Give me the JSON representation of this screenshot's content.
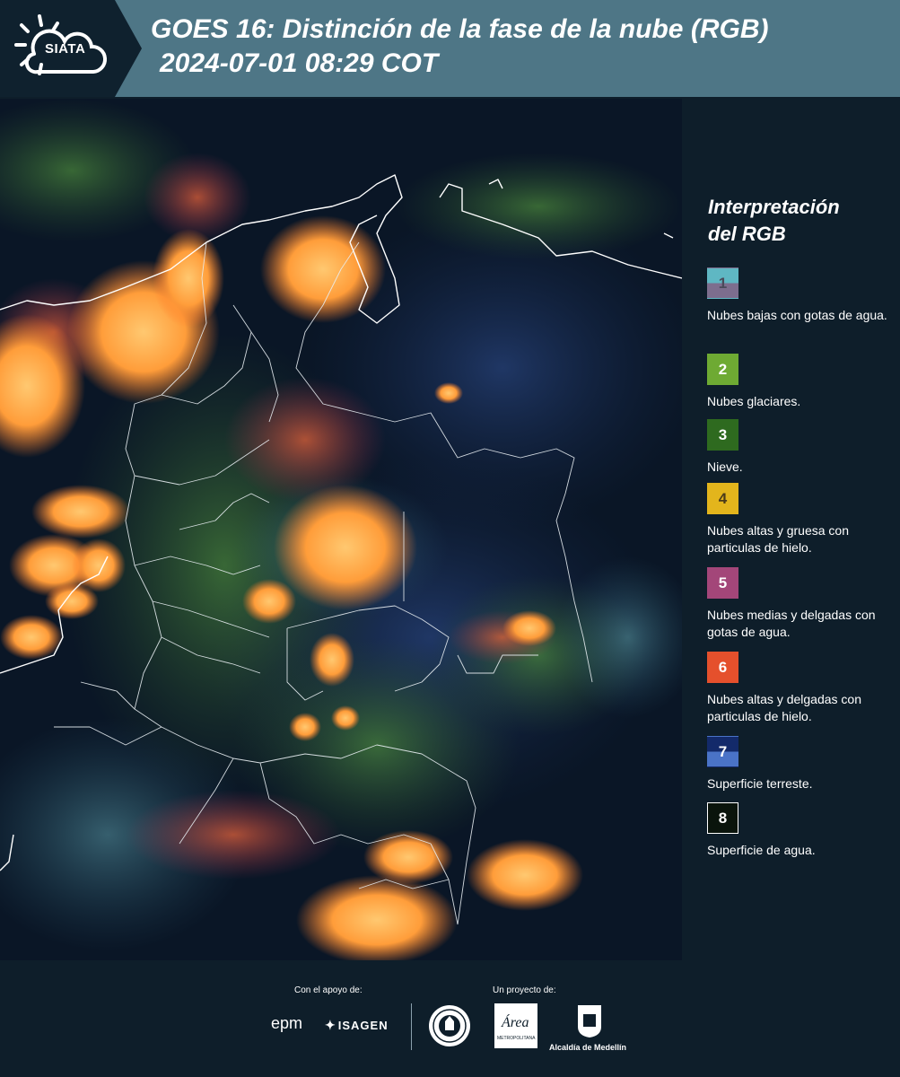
{
  "header": {
    "logo_text": "SIATA",
    "title_line1": "GOES 16: Distinción de la fase de la nube (RGB)",
    "title_line2": "2024-07-01 08:29 COT"
  },
  "legend": {
    "title_line1": "Interpretación",
    "title_line2": "del RGB",
    "items": [
      {
        "number": "1",
        "label": "Nubes bajas con gotas de agua.",
        "color_top": "#5fb7c3",
        "color_bottom": "#7d6e8e",
        "text_color": "#4a4a5a"
      },
      {
        "number": "2",
        "label": "Nubes glaciares.",
        "color_top": "#6eaa33",
        "color_bottom": "#6eaa33",
        "text_color": "#ffffff"
      },
      {
        "number": "3",
        "label": "Nieve.",
        "color_top": "#2e6a1f",
        "color_bottom": "#2e6a1f",
        "text_color": "#ffffff"
      },
      {
        "number": "4",
        "label": "Nubes altas y gruesa con particulas de hielo.",
        "color_top": "#e3b51c",
        "color_bottom": "#e3b51c",
        "text_color": "#4a3a1a"
      },
      {
        "number": "5",
        "label": "Nubes medias y delgadas con gotas de agua.",
        "color_top": "#a34679",
        "color_bottom": "#a34679",
        "text_color": "#ffffff"
      },
      {
        "number": "6",
        "label": "Nubes altas y delgadas con particulas de hielo.",
        "color_top": "#e5502c",
        "color_bottom": "#e5502c",
        "text_color": "#ffffff"
      },
      {
        "number": "7",
        "label": "Superficie terreste.",
        "color_top": "#132a6a",
        "color_bottom": "#4a73c7",
        "text_color": "#ffffff"
      },
      {
        "number": "8",
        "label": "Superficie de agua.",
        "color_top": "#0a140c",
        "color_bottom": "#0a140c",
        "text_color": "#ffffff",
        "border": "#ffffff"
      }
    ]
  },
  "footer": {
    "support_label": "Con el apoyo de:",
    "project_label": "Un proyecto de:",
    "sponsor1": "epm",
    "sponsor2": "ISAGEN",
    "partner_alcaldia": "Alcaldía de Medellín",
    "partner_area_text": "Área",
    "partner_area_sub": "METROPOLITANA"
  }
}
